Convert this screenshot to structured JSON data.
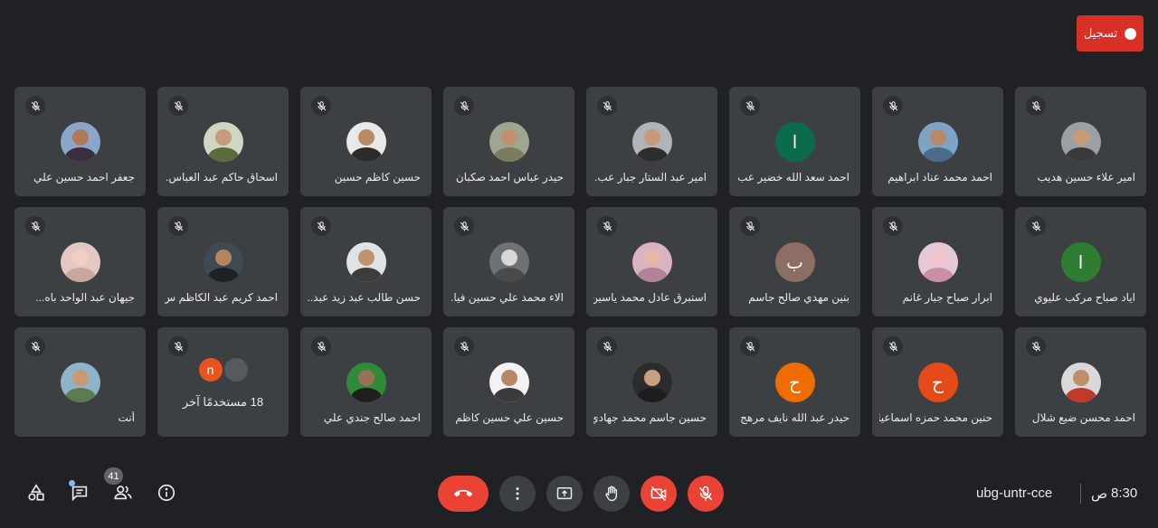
{
  "recording": {
    "label": "تسجيل"
  },
  "tiles": [
    {
      "name": "امير علاء حسين هديب",
      "avatar": "photo",
      "photo_bg": "#9aa0a6",
      "skin": "#c99a78",
      "shirt": "#3a3a3a"
    },
    {
      "name": "احمد محمد عناد ابراهيم",
      "avatar": "photo",
      "photo_bg": "#7fa3c4",
      "skin": "#b88a68",
      "shirt": "#4a6b8a"
    },
    {
      "name": "احمد سعد الله خضير عب...",
      "avatar": "letter",
      "letter": "ا",
      "color": "#0b6b4b"
    },
    {
      "name": "امير عبد الستار جبار عب...",
      "avatar": "photo",
      "photo_bg": "#b0b4b8",
      "skin": "#c49a7a",
      "shirt": "#2d2d2d"
    },
    {
      "name": "حيدر عباس احمد صكبان",
      "avatar": "photo",
      "photo_bg": "#9fa68f",
      "skin": "#c09070",
      "shirt": "#7a7c60"
    },
    {
      "name": "حسين كاظم حسين",
      "avatar": "photo",
      "photo_bg": "#e9e9e9",
      "skin": "#b98a66",
      "shirt": "#2b2b2b"
    },
    {
      "name": "اسحاق حاكم عبد العباس...",
      "avatar": "photo",
      "photo_bg": "#cfd6c4",
      "skin": "#c69c7c",
      "shirt": "#5b6b3a"
    },
    {
      "name": "جعفر احمد حسين علي",
      "avatar": "photo",
      "photo_bg": "#8aa6c8",
      "skin": "#b07a5a",
      "shirt": "#3a2f40"
    },
    {
      "name": "اياد صباح مركب عليوي",
      "avatar": "letter",
      "letter": "ا",
      "color": "#2e7d32"
    },
    {
      "name": "ابرار صباح جبار غانم",
      "avatar": "photo",
      "photo_bg": "#e6c9d6",
      "skin": "#f0c4cc",
      "shirt": "#c98fa4"
    },
    {
      "name": "بنين مهدي صالح جاسم",
      "avatar": "letter",
      "letter": "ب",
      "color": "#8d6e63"
    },
    {
      "name": "استبرق عادل محمد ياسين",
      "avatar": "photo",
      "photo_bg": "#d7b4c0",
      "skin": "#e6b7a8",
      "shirt": "#b48296"
    },
    {
      "name": "الاء محمد علي حسين فيا...",
      "avatar": "photo",
      "photo_bg": "#6f7275",
      "skin": "#d8d8d8",
      "shirt": "#4a4a4a"
    },
    {
      "name": "حسن طالب عبد زيد عبد...",
      "avatar": "photo",
      "photo_bg": "#dfe3e6",
      "skin": "#c29170",
      "shirt": "#3c3c3c"
    },
    {
      "name": "احمد كريم عبد الكاظم س...",
      "avatar": "photo",
      "photo_bg": "#3f4a52",
      "skin": "#b58460",
      "shirt": "#1f2224"
    },
    {
      "name": "جيهان عبد الواحد باه...",
      "avatar": "photo",
      "photo_bg": "#e3c8c4",
      "skin": "#f1cfc2",
      "shirt": "#c9a6a0"
    },
    {
      "name": "احمد محسن ضبع شلال",
      "avatar": "photo",
      "photo_bg": "#d9d9d9",
      "skin": "#c28e6a",
      "shirt": "#c0392b"
    },
    {
      "name": "حنين محمد حمزه اسماعيل",
      "avatar": "letter",
      "letter": "ح",
      "color": "#e64a19"
    },
    {
      "name": "حيدر عبد الله نايف مرهج",
      "avatar": "letter",
      "letter": "ح",
      "color": "#ef6c00"
    },
    {
      "name": "حسين جاسم محمد جهادي",
      "avatar": "photo",
      "photo_bg": "#2c2c2c",
      "skin": "#c8a080",
      "shirt": "#1d1d1d"
    },
    {
      "name": "حسين علي حسين كاظم",
      "avatar": "photo",
      "photo_bg": "#f2f2f2",
      "skin": "#b8876a",
      "shirt": "#3b3b3b"
    },
    {
      "name": "احمد صالح جندي علي",
      "avatar": "photo",
      "photo_bg": "#2f8a3a",
      "skin": "#9a7058",
      "shirt": "#1f1f1f"
    },
    {
      "name": "18 مستخدمًا آخر",
      "avatar": "others",
      "letter": "n",
      "color": "#e8541c"
    },
    {
      "name": "أنت",
      "avatar": "photo",
      "photo_bg": "#8fb3c9",
      "skin": "#c89a74",
      "shirt": "#5d7a52"
    }
  ],
  "bottom_bar": {
    "people_count": "41",
    "meeting_code": "ubg-untr-cce",
    "time": "8:30",
    "time_suffix": "ص"
  }
}
